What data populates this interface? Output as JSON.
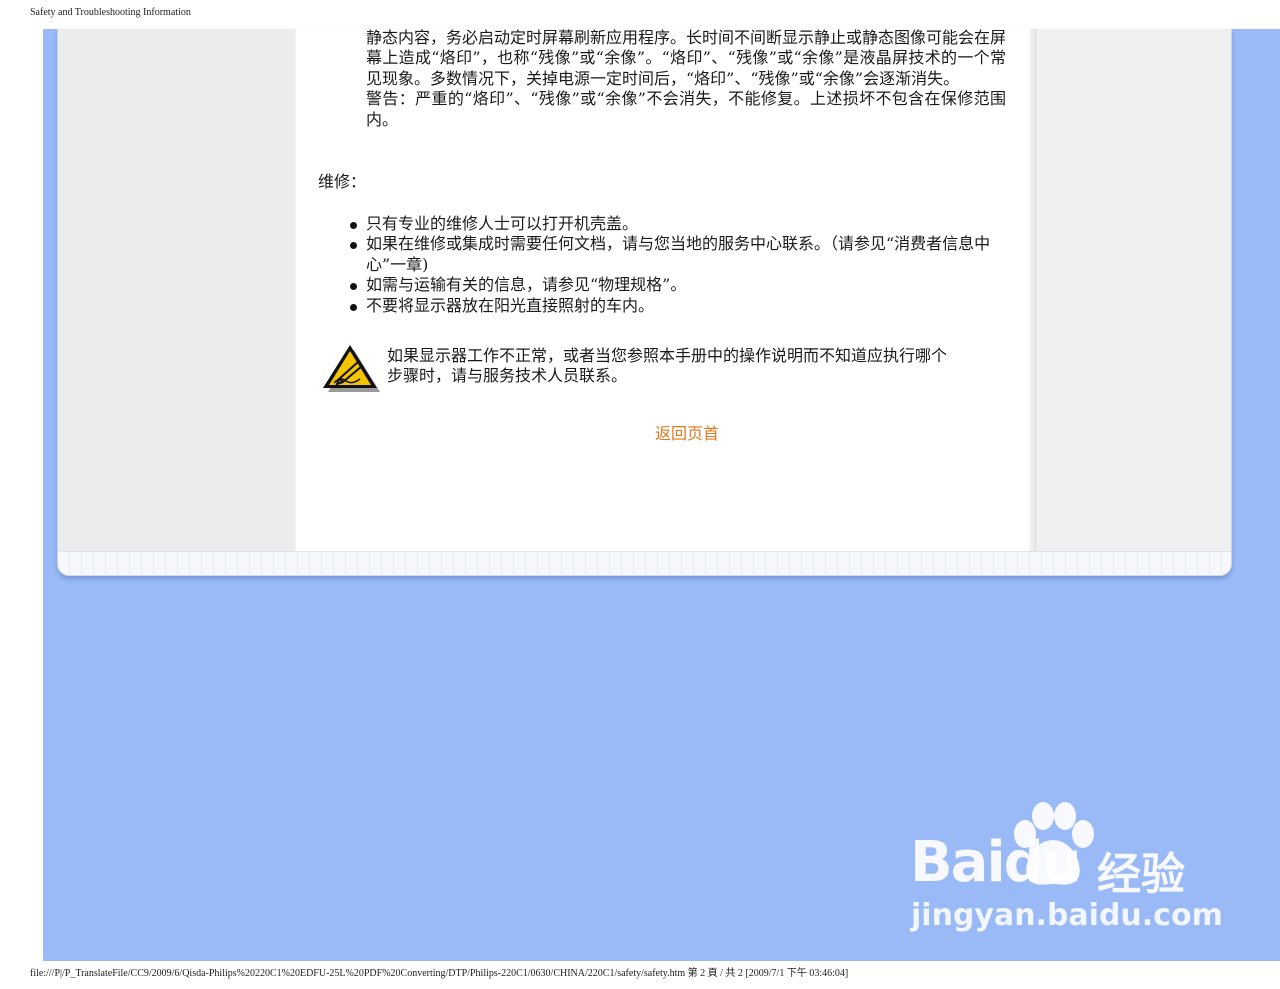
{
  "print_header": "Safety and Troubleshooting Information",
  "intro_paragraph": "静态内容，务必启动定时屏幕刷新应用程序。长时间不间断显示静止或静态图像可能会在屏幕上造成“烙印”，也称“残像”或“余像”。“烙印”、“残像”或“余像”是液晶屏技术的一个常见现象。多数情况下，关掉电源一定时间后，“烙印”、“残像”或“余像”会逐渐消失。",
  "warning_paragraph": "警告：严重的“烙印”、“残像”或“余像”不会消失，不能修复。上述损坏不包含在保修范围内。",
  "section_title": "维修：",
  "bullets": [
    "只有专业的维修人士可以打开机壳盖。",
    "如果在维修或集成时需要任何文档，请与您当地的服务中心联系。（请参见“消费者信息中心”一章)",
    "如需与运输有关的信息，请参见“物理规格”。",
    "不要将显示器放在阳光直接照射的车内。"
  ],
  "notice_text": "如果显示器工作不正常，或者当您参照本手册中的操作说明而不知道应执行哪个步骤时，请与服务技术人员联系。",
  "back_to_top": "返回页首",
  "watermark": {
    "brand": "Baidu",
    "chinese": "经验",
    "domain": "jingyan.baidu.com"
  },
  "print_footer": "file:///P|/P_TranslateFile/CC9/2009/6/Qisda-Philips%20220C1%20EDFU-25L%20PDF%20Converting/DTP/Philips-220C1/0630/CHINA/220C1/safety/safety.htm 第 2 頁 / 共 2  [2009/7/1 下午 03:46:04]",
  "colors": {
    "page_background": "#99b9f7",
    "link": "#e07a20",
    "warning_yellow": "#f5c400"
  },
  "icons": {
    "notice": "warning-triangle-icon",
    "watermark": "baidu-paw-icon"
  }
}
